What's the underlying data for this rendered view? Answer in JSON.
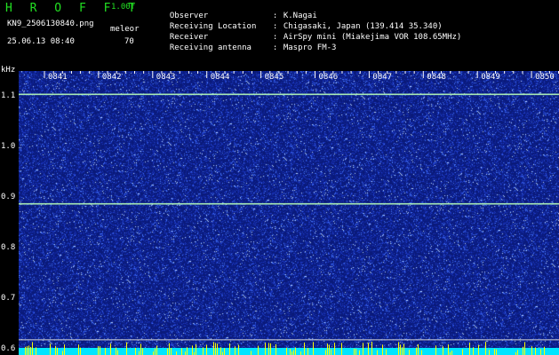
{
  "header": {
    "app_title": "H R O F F T",
    "version": "1.00f",
    "file_name": "KN9_2506130840.png",
    "datetime": "25.06.13 08:40",
    "program_label": "meleor",
    "program_value": "70"
  },
  "info": [
    {
      "label": "Observer",
      "sep": ":",
      "value": "K.Nagai"
    },
    {
      "label": "Receiving Location",
      "sep": ":",
      "value": "Chigasaki, Japan (139.414 35.340)"
    },
    {
      "label": "Receiver",
      "sep": ":",
      "value": "AirSpy mini (Miakejima VOR 108.65MHz)"
    },
    {
      "label": "Receiving antenna",
      "sep": ":",
      "value": "Maspro FM-3"
    }
  ],
  "spectrogram": {
    "unit_label": "kHz",
    "y_ticks": [
      "1.1",
      "1.0",
      "0.9",
      "0.8",
      "0.7",
      "0.6"
    ],
    "x_ticks": [
      "0841",
      "0842",
      "0843",
      "0844",
      "0845",
      "0846",
      "0847",
      "0848",
      "0849",
      "0850"
    ],
    "freq_range_khz": [
      0.59,
      1.15
    ],
    "carrier_lines_khz": [
      1.104,
      0.888
    ],
    "marker_lines_khz": [
      0.62,
      0.6
    ],
    "colors": {
      "background": "#0a1a7a",
      "noise": "#3a6cff",
      "carrier": "#b8ffb8",
      "bottom_band": "#00e5ff",
      "meteor_spike": "#ffff00",
      "text_green": "#22e022"
    }
  }
}
